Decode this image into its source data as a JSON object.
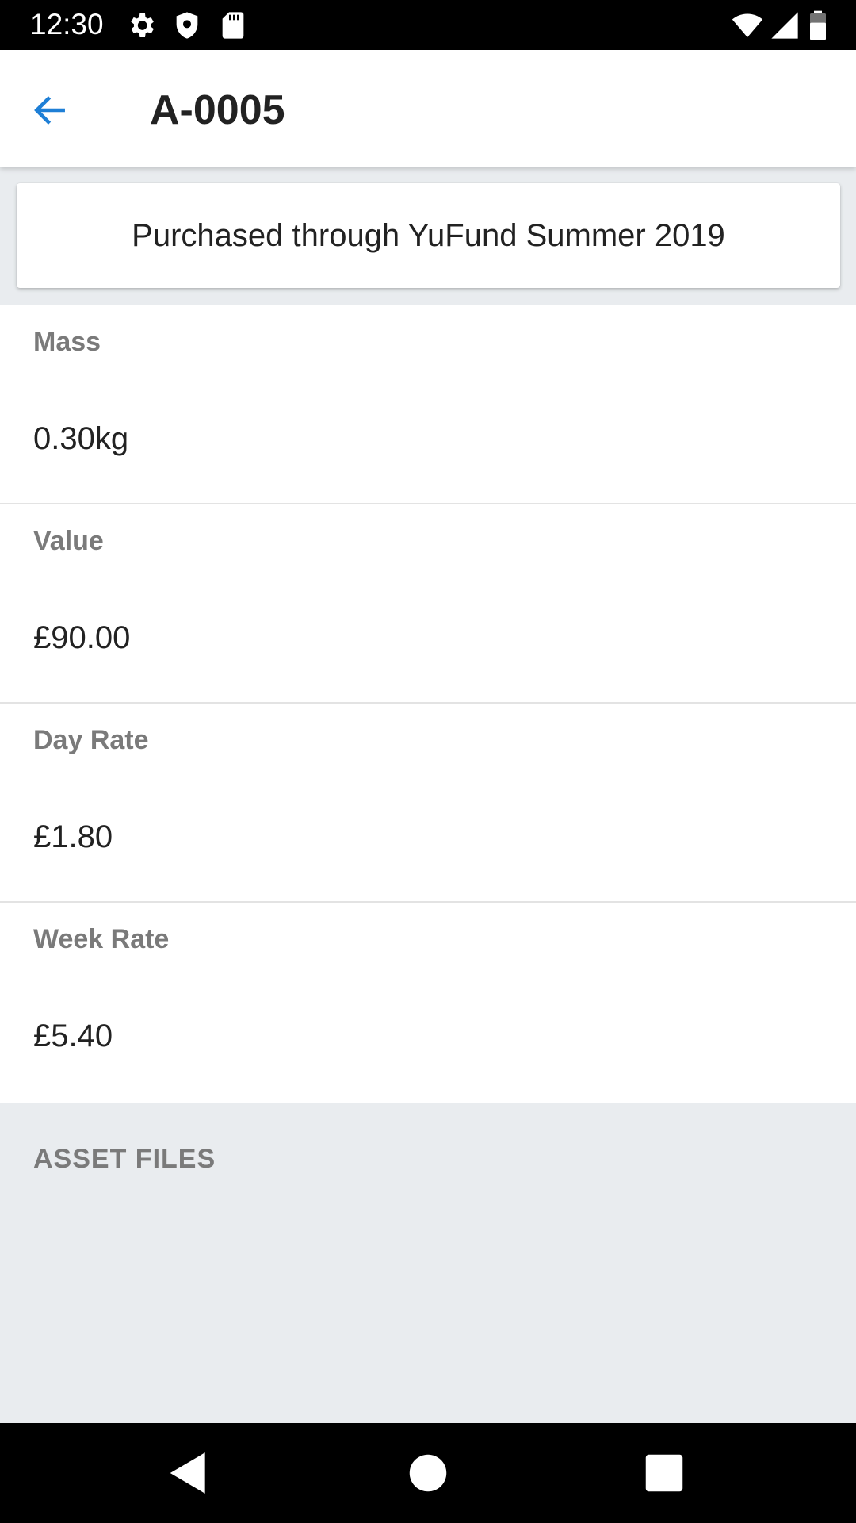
{
  "status_bar": {
    "time": "12:30",
    "icons_left": [
      "gear-icon",
      "shield-icon",
      "sd-card-icon"
    ],
    "icons_right": [
      "wifi-icon",
      "signal-icon",
      "battery-icon"
    ]
  },
  "header": {
    "title": "A-0005",
    "back_icon": "arrow-left-icon",
    "accent_color": "#1e7fd6"
  },
  "note": {
    "text": "Purchased through YuFund Summer 2019"
  },
  "details": [
    {
      "label": "Mass",
      "value": "0.30kg"
    },
    {
      "label": "Value",
      "value": "£90.00"
    },
    {
      "label": "Day Rate",
      "value": "£1.80"
    },
    {
      "label": "Week Rate",
      "value": "£5.40"
    }
  ],
  "asset_files": {
    "header": "ASSET FILES"
  },
  "nav_bar": {
    "buttons": [
      "back-triangle-icon",
      "home-circle-icon",
      "recents-square-icon"
    ]
  }
}
